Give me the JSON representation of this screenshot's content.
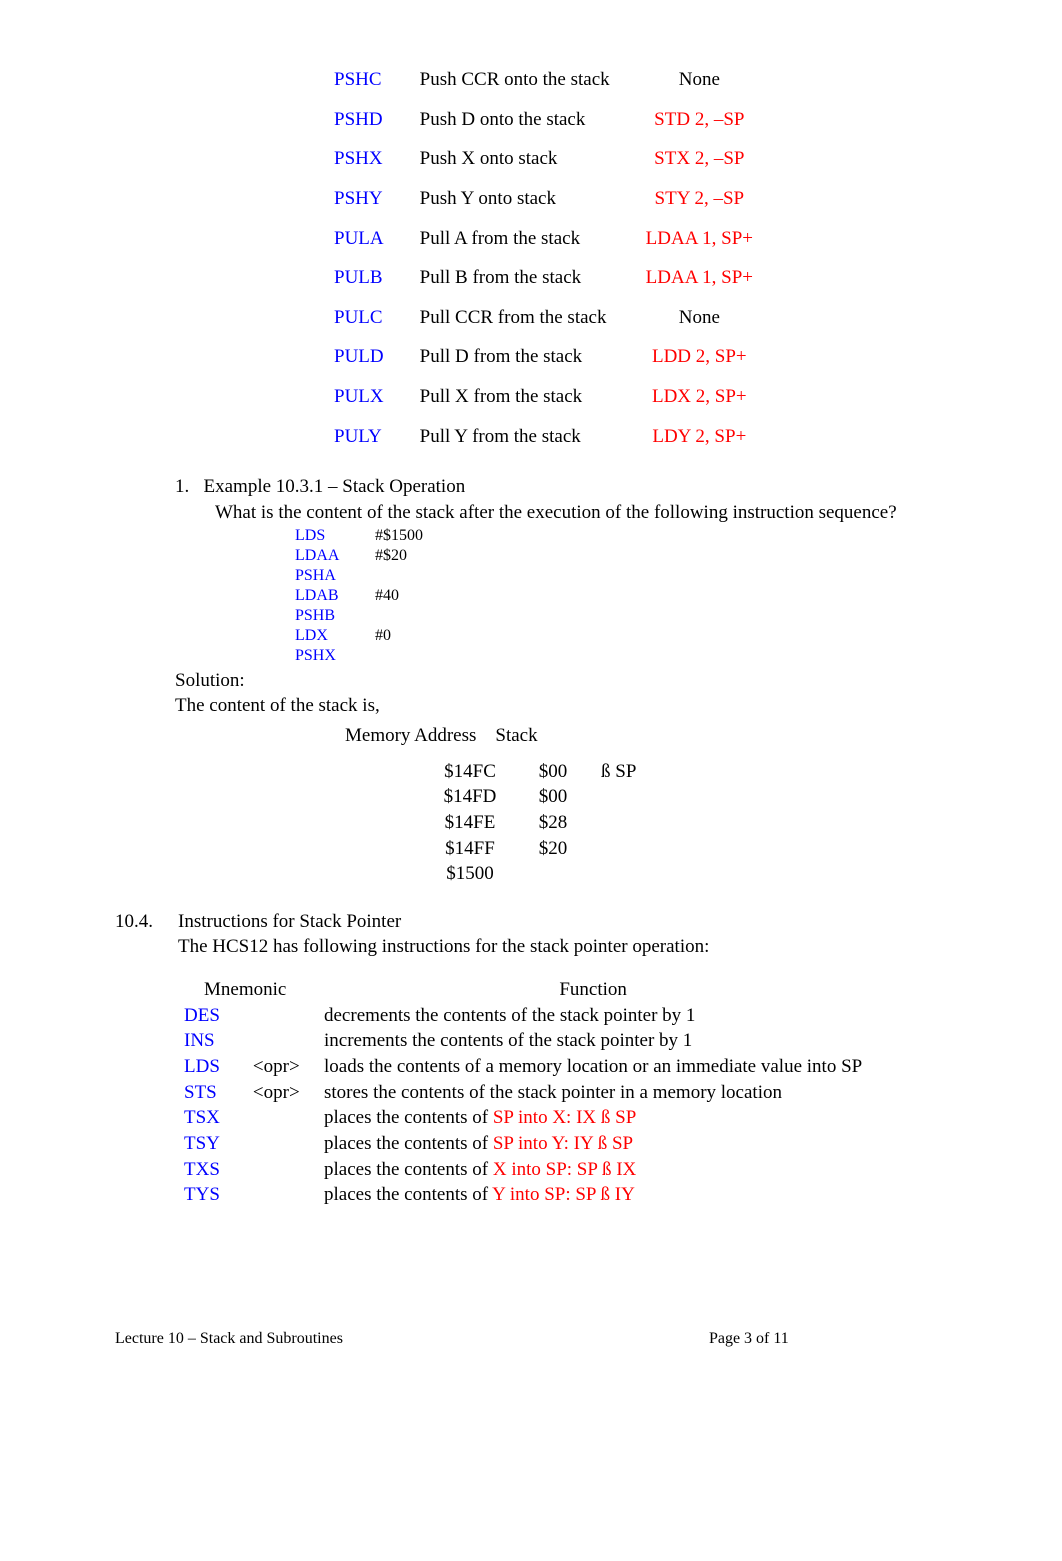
{
  "stack_ops": [
    {
      "mnemonic": "PSHC",
      "desc": "Push CCR onto the stack",
      "eq": "None",
      "eq_is_none": true
    },
    {
      "mnemonic": "PSHD",
      "desc": "Push D onto the stack",
      "eq": "STD 2, –SP"
    },
    {
      "mnemonic": "PSHX",
      "desc": "Push X onto stack",
      "eq": "STX 2, –SP"
    },
    {
      "mnemonic": "PSHY",
      "desc": "Push Y onto stack",
      "eq": "STY 2, –SP"
    },
    {
      "mnemonic": "PULA",
      "desc": "Pull A from the stack",
      "eq": "LDAA 1, SP+"
    },
    {
      "mnemonic": "PULB",
      "desc": "Pull B from the stack",
      "eq": "LDAA 1, SP+"
    },
    {
      "mnemonic": "PULC",
      "desc": "Pull CCR from the stack",
      "eq": "None",
      "eq_is_none": true
    },
    {
      "mnemonic": "PULD",
      "desc": "Pull D from the stack",
      "eq": "LDD 2, SP+"
    },
    {
      "mnemonic": "PULX",
      "desc": "Pull X from the stack",
      "eq": "LDX 2, SP+"
    },
    {
      "mnemonic": "PULY",
      "desc": "Pull Y from the stack",
      "eq": "LDY 2, SP+"
    }
  ],
  "example": {
    "number": "1.",
    "title": "Example 10.3.1 – Stack Operation",
    "question": "What is the content of the stack after the execution of the following instruction sequence?",
    "code": [
      {
        "mn": "LDS",
        "arg": "#$1500"
      },
      {
        "mn": "LDAA",
        "arg": "#$20"
      },
      {
        "mn": "PSHA",
        "arg": ""
      },
      {
        "mn": "LDAB",
        "arg": "#40"
      },
      {
        "mn": "PSHB",
        "arg": ""
      },
      {
        "mn": "LDX",
        "arg": "#0"
      },
      {
        "mn": "PSHX",
        "arg": ""
      }
    ],
    "solution_label": "Solution:",
    "content_label": "The content of the stack is,",
    "mem_head_addr": "Memory Address",
    "mem_head_stack": "Stack",
    "mem": [
      {
        "addr": "$14FC",
        "val": "$00",
        "sp_arrow": "ß",
        "sp_label": "SP"
      },
      {
        "addr": "$14FD",
        "val": "$00"
      },
      {
        "addr": "$14FE",
        "val": "$28"
      },
      {
        "addr": "$14FF",
        "val": "$20"
      },
      {
        "addr": "$1500",
        "val": ""
      }
    ]
  },
  "section104": {
    "num": "10.4.",
    "title": "Instructions for Stack Pointer",
    "subtitle": "The HCS12 has following instructions for the stack pointer operation:",
    "head_mn": "Mnemonic",
    "head_fn": "Function",
    "rows": [
      {
        "mn": "DES",
        "opr": "",
        "fn_plain": "decrements the contents of the stack pointer by 1"
      },
      {
        "mn": "INS",
        "opr": "",
        "fn_plain": "increments the contents of the stack pointer by 1"
      },
      {
        "mn": "LDS",
        "opr": "<opr>",
        "fn_plain": "loads the contents of a memory location or an immediate value into SP"
      },
      {
        "mn": "STS",
        "opr": "<opr>",
        "fn_plain": "stores the contents of the stack pointer in a memory location"
      },
      {
        "mn": "TSX",
        "opr": "",
        "fn_prefix": "places the contents of ",
        "fn_red": "SP into X: IX ß  SP"
      },
      {
        "mn": "TSY",
        "opr": "",
        "fn_prefix": "places the contents of ",
        "fn_red": "SP into Y: IY ß  SP"
      },
      {
        "mn": "TXS",
        "opr": "",
        "fn_prefix": "places the contents of ",
        "fn_red": "X into SP: SP ß  IX"
      },
      {
        "mn": "TYS",
        "opr": "",
        "fn_prefix": "places the contents of ",
        "fn_red": "Y into SP: SP ß  IY"
      }
    ]
  },
  "footer": {
    "left": "Lecture 10 – Stack and Subroutines",
    "right": "Page 3 of 11"
  }
}
